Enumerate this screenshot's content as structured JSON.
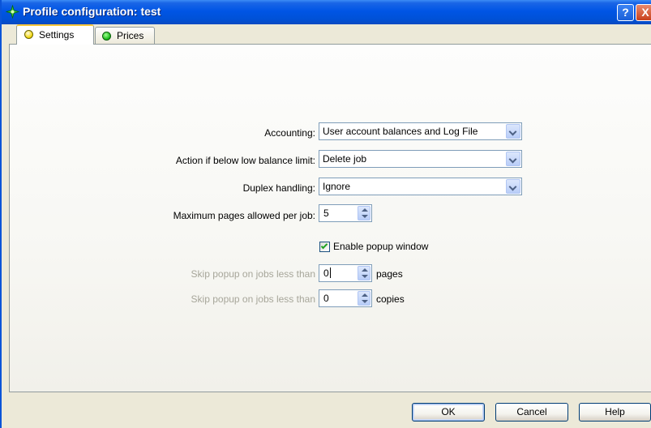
{
  "window": {
    "title": "Profile configuration: test",
    "help_button": "?",
    "close_button": "X",
    "accent": "#0055e5"
  },
  "tabs": [
    {
      "label": "Settings",
      "active": true,
      "dot_color": "#f0d400"
    },
    {
      "label": "Prices",
      "active": false,
      "dot_color": "#12b612"
    }
  ],
  "form": {
    "accounting": {
      "label": "Accounting:",
      "value": "User account balances and Log File"
    },
    "low_balance_action": {
      "label": "Action if below low balance limit:",
      "value": "Delete job"
    },
    "duplex": {
      "label": "Duplex handling:",
      "value": "Ignore"
    },
    "max_pages": {
      "label": "Maximum pages allowed per job:",
      "value": "5"
    },
    "popup": {
      "label": "Enable popup window",
      "checked": true
    },
    "skip_pages": {
      "label": "Skip popup on jobs less than",
      "value": "0",
      "unit": "pages",
      "disabled": true
    },
    "skip_copies": {
      "label": "Skip popup on jobs less than",
      "value": "0",
      "unit": "copies",
      "disabled": true
    }
  },
  "buttons": {
    "ok": "OK",
    "cancel": "Cancel",
    "help": "Help"
  }
}
